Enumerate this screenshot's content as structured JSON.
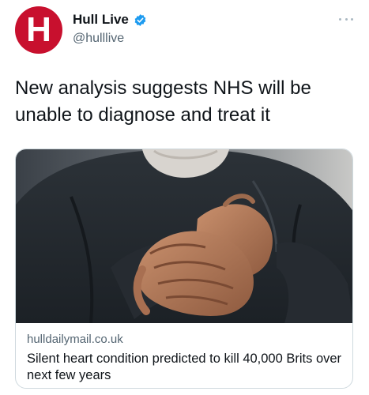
{
  "account": {
    "avatar_letter": "H",
    "name": "Hull Live",
    "handle": "@hulllive",
    "verified": true
  },
  "icons": {
    "verified": "verified-badge-icon",
    "more": "more-options-icon"
  },
  "tweet": {
    "text": "New analysis suggests NHS will be unable to diagnose and treat it"
  },
  "link_card": {
    "domain": "hulldailymail.co.uk",
    "title": "Silent heart condition predicted to kill 40,000 Brits over next few years"
  },
  "colors": {
    "brand_red": "#c8102e",
    "verified_blue": "#1d9bf0",
    "secondary_text": "#536471"
  }
}
